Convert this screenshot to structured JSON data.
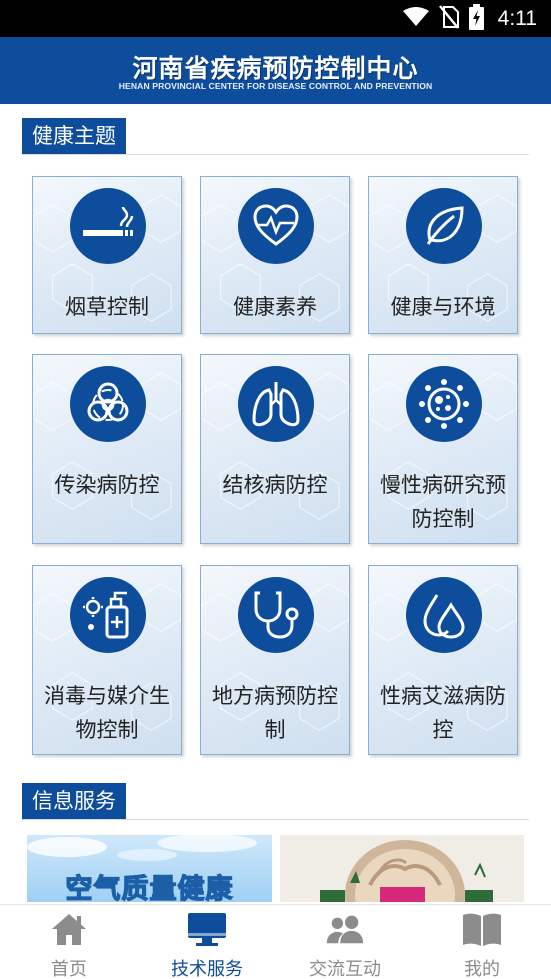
{
  "status_bar": {
    "time": "4:11",
    "icons": [
      "wifi-icon",
      "no-sim-icon",
      "battery-charging-icon"
    ]
  },
  "header": {
    "title": "河南省疾病预防控制中心",
    "subtitle": "HENAN PROVINCIAL CENTER FOR DISEASE CONTROL AND PREVENTION",
    "background": "#0e4d9b"
  },
  "health_section": {
    "title": "健康主题",
    "items": [
      {
        "label": "烟草控制",
        "icon": "cigarette-icon"
      },
      {
        "label": "健康素养",
        "icon": "heart-pulse-icon"
      },
      {
        "label": "健康与环境",
        "icon": "leaf-icon"
      },
      {
        "label": "传染病防控",
        "icon": "biohazard-icon"
      },
      {
        "label": "结核病防控",
        "icon": "lungs-icon"
      },
      {
        "label": "慢性病研究预防控制",
        "icon": "virus-icon"
      },
      {
        "label": "消毒与媒介生物控制",
        "icon": "sanitizer-icon"
      },
      {
        "label": "地方病预防控制",
        "icon": "stethoscope-icon"
      },
      {
        "label": "性病艾滋病防控",
        "icon": "drops-icon"
      }
    ]
  },
  "info_section": {
    "title": "信息服务",
    "banners": [
      {
        "text": "空气质量健康"
      },
      {
        "text": ""
      }
    ]
  },
  "tab_bar": {
    "items": [
      {
        "label": "首页",
        "icon": "home-icon",
        "active": false
      },
      {
        "label": "技术服务",
        "icon": "monitor-icon",
        "active": true
      },
      {
        "label": "交流互动",
        "icon": "users-icon",
        "active": false
      },
      {
        "label": "我的",
        "icon": "book-icon",
        "active": false
      }
    ],
    "active_color": "#0e4d9b",
    "inactive_color": "#8c8c8c"
  }
}
